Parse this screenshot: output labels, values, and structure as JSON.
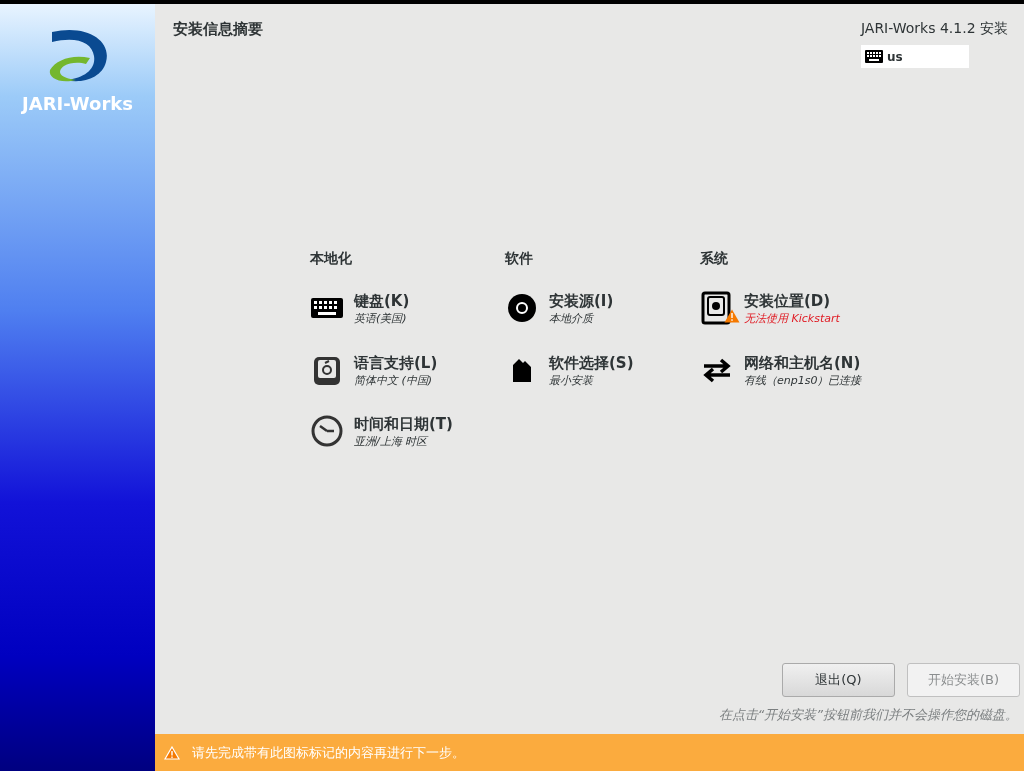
{
  "sidebar": {
    "logo_text": "JARI-Works"
  },
  "header": {
    "title": "安装信息摘要",
    "product": "JARI-Works 4.1.2 安装",
    "keyboard_layout": "us"
  },
  "categories": [
    {
      "title": "本地化",
      "spokes": [
        {
          "kind": "keyboard",
          "title": "键盘(K)",
          "status": "英语(美国)",
          "warning": false
        },
        {
          "kind": "language",
          "title": "语言支持(L)",
          "status": "简体中文 (中国)",
          "warning": false
        },
        {
          "kind": "clock",
          "title": "时间和日期(T)",
          "status": "亚洲/上海 时区",
          "warning": false
        }
      ]
    },
    {
      "title": "软件",
      "spokes": [
        {
          "kind": "disc",
          "title": "安装源(I)",
          "status": "本地介质",
          "warning": false
        },
        {
          "kind": "package",
          "title": "软件选择(S)",
          "status": "最小安装",
          "warning": false
        }
      ]
    },
    {
      "title": "系统",
      "spokes": [
        {
          "kind": "disk",
          "title": "安装位置(D)",
          "status": "无法使用 Kickstart",
          "warning": true
        },
        {
          "kind": "network",
          "title": "网络和主机名(N)",
          "status": "有线（enp1s0）已连接",
          "warning": false
        }
      ]
    }
  ],
  "buttons": [
    {
      "label": "退出(Q)",
      "disabled": false
    },
    {
      "label": "开始安装(B)",
      "disabled": true
    }
  ],
  "note": "在点击“开始安装”按钮前我们并不会操作您的磁盘。",
  "warning_bar": {
    "text": "请先完成带有此图标标记的内容再进行下一步。"
  }
}
